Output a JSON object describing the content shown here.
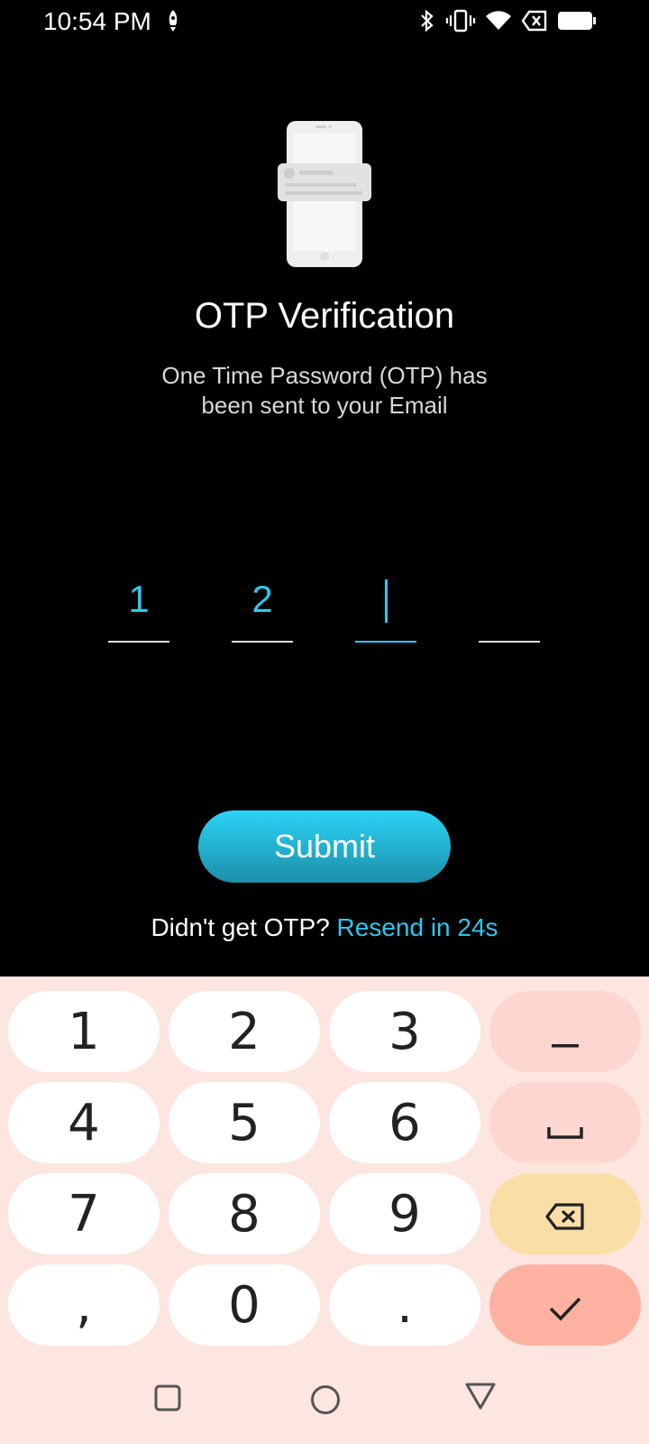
{
  "status_bar": {
    "time": "10:54 PM"
  },
  "screen": {
    "title": "OTP Verification",
    "subtitle": "One Time Password (OTP) has been sent to your Email"
  },
  "otp": {
    "digits": [
      "1",
      "2",
      "",
      ""
    ],
    "active_index": 2
  },
  "submit_label": "Submit",
  "resend": {
    "prompt": "Didn't get OTP?",
    "link": "Resend in 24s"
  },
  "keyboard": {
    "keys": [
      "1",
      "2",
      "3",
      "–",
      "4",
      "5",
      "6",
      "␣",
      "7",
      "8",
      "9",
      "⌫",
      ",",
      "0",
      ".",
      "✓"
    ]
  },
  "colors": {
    "accent": "#2ec6ee",
    "keyboard_bg": "#fde5e0",
    "backspace_key": "#f9dfa6",
    "enter_key": "#ffb1a2"
  }
}
